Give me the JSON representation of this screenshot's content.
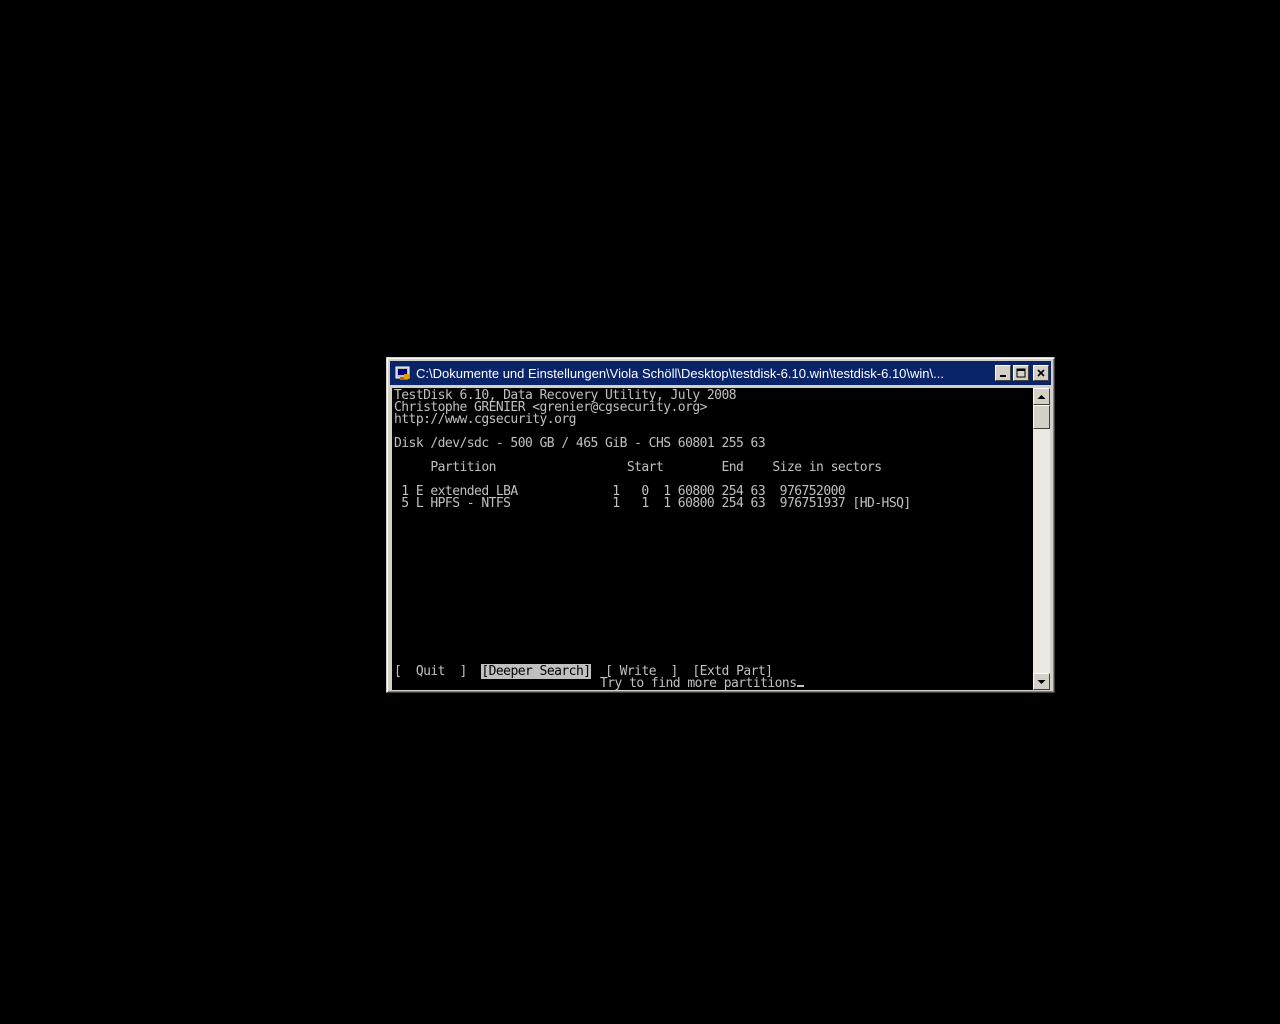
{
  "window": {
    "title": "C:\\Dokumente und Einstellungen\\Viola Schöll\\Desktop\\testdisk-6.10.win\\testdisk-6.10\\win\\...",
    "icon": "console-app-icon",
    "buttons": {
      "minimize": "minimize-icon",
      "maximize": "maximize-icon",
      "close": "close-icon"
    }
  },
  "console": {
    "header": [
      "TestDisk 6.10, Data Recovery Utility, July 2008",
      "Christophe GRENIER <grenier@cgsecurity.org>",
      "http://www.cgsecurity.org"
    ],
    "disk_line": "Disk /dev/sdc - 500 GB / 465 GiB - CHS 60801 255 63",
    "column_header": "     Partition                  Start        End    Size in sectors",
    "partitions": [
      " 1 E extended LBA             1   0  1 60800 254 63  976752000",
      " 5 L HPFS - NTFS              1   1  1 60800 254 63  976751937 [HD-HSQ]"
    ],
    "menu": {
      "quit": "[  Quit  ]",
      "deeper_search": "[Deeper Search]",
      "write": "[ Write  ]",
      "extd_part": "[Extd Part]"
    },
    "status": "Try to find more partitions"
  },
  "colors": {
    "desktop": "#000000",
    "titlebar": "#0a246a",
    "console_bg": "#000000",
    "console_text": "#c0c0c0",
    "window_frame": "#d4d0c8"
  }
}
